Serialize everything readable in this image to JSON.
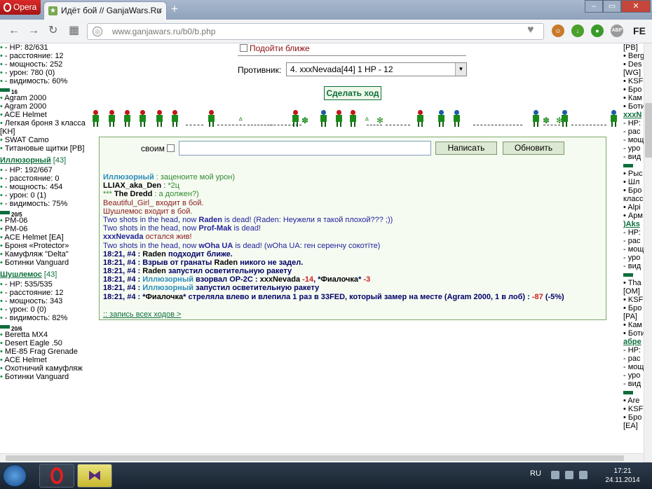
{
  "browser": {
    "menu_label": "Opera",
    "tab_title": "Идёт бой // GanjaWars.Ru",
    "tab_close": "×",
    "new_tab": "+",
    "window_min": "–",
    "window_max": "▭",
    "window_close": "✕",
    "url": "www.ganjawars.ru/b0/b.php",
    "nav_back": "←",
    "nav_forward": "→",
    "nav_reload": "↻",
    "nav_speeddial": "▦",
    "heart": "♥",
    "ext_abp": "ABP",
    "ext_fe": "FE"
  },
  "left_panel": {
    "top_lines": [
      {
        "dot": true,
        "text": "- HP: 82/631"
      },
      {
        "dot": true,
        "text": "- расстояние: 12"
      },
      {
        "dot": true,
        "text": "- мощность: 252"
      },
      {
        "dot": true,
        "text": "- урон: 780 (0)"
      },
      {
        "dot": true,
        "text": "- видимость: 60%"
      }
    ],
    "top_gun": "16",
    "top_items": [
      "Agram 2000",
      "Agram 2000",
      "ACE Helmet",
      "Легкая броня 3 класса [KH]",
      "SWAT Camo",
      "Титановые щитки [PB]"
    ],
    "players": [
      {
        "name": "Иллюзорный",
        "level": "[43]",
        "stats": [
          "- HP: 192/667",
          "- расстояние: 0",
          "- мощность: 454",
          "- урон: 0 (1)",
          "- видимость: 75%"
        ],
        "gun": "20/5",
        "items": [
          "PM-06",
          "PM-06",
          "ACE Helmet [EA]",
          "Броня «Protector»",
          "Камуфляж \"Delta\"",
          "Ботинки Vanguard"
        ]
      },
      {
        "name": "Шушлемос",
        "level": "[43]",
        "stats": [
          "- HP: 535/535",
          "- расстояние: 12",
          "- мощность: 343",
          "- урон: 0 (0)",
          "- видимость: 82%"
        ],
        "gun": "20/6",
        "items": [
          "Beretta MX4",
          "Desert Eagle .50",
          "ME-85 Frag Grenade",
          "ACE Helmet",
          "Охотничий камуфляж",
          "Ботинки Vanguard"
        ]
      }
    ]
  },
  "battle": {
    "approach_label": "Подойти ближе",
    "opponent_label": "Противник:",
    "opponent_selected": "4. xxxNevada[44] 1 HP - 12",
    "make_move": "Сделать ход"
  },
  "chat": {
    "own_label": "своим",
    "input_value": "",
    "write_button": "Написать",
    "refresh_button": "Обновить",
    "all_moves_link": ":: запись всех ходов >"
  },
  "log": [
    [
      {
        "t": "Иллюзорный",
        "c": "bcyan"
      },
      {
        "t": " : заценоите мой урон)",
        "c": "c-green"
      }
    ],
    [
      {
        "t": "LLIAX_aka_Den",
        "c": "bold"
      },
      {
        "t": " : ",
        "c": "c-blue"
      },
      {
        "t": "*2ц",
        "c": "c-green"
      }
    ],
    [
      {
        "t": "*** ",
        "c": "c-green"
      },
      {
        "t": "The Dredd",
        "c": "bold"
      },
      {
        "t": " : а должен?)",
        "c": "c-green"
      }
    ],
    [
      {
        "t": "Beautiful_Girl_ входит в бой.",
        "c": "c-dkred"
      }
    ],
    [
      {
        "t": "Шушлемос входит в бой.",
        "c": "c-dkred"
      }
    ],
    [
      {
        "t": "Two shots in the head, now ",
        "c": "c-blue"
      },
      {
        "t": "Raden",
        "c": "bblue"
      },
      {
        "t": " is dead! (Raden: Неужели я такой плохой??? ;))",
        "c": "c-blue"
      }
    ],
    [
      {
        "t": "Two shots in the head, now ",
        "c": "c-blue"
      },
      {
        "t": "Prof-Mak",
        "c": "bblue"
      },
      {
        "t": " is dead!",
        "c": "c-blue"
      }
    ],
    [
      {
        "t": "xxxNevada",
        "c": "bblue"
      },
      {
        "t": " остался жив!",
        "c": "c-dkred"
      }
    ],
    [
      {
        "t": "Two shots in the head, now ",
        "c": "c-blue"
      },
      {
        "t": "wOha UA",
        "c": "bblue"
      },
      {
        "t": " is dead! (wOha UA: ген серенчу сокотїте)",
        "c": "c-blue"
      }
    ],
    [
      {
        "t": "18:21, #4 : ",
        "c": "navy"
      },
      {
        "t": "Raden",
        "c": "bold"
      },
      {
        "t": " подходит ближе.",
        "c": "navy"
      }
    ],
    [
      {
        "t": "18:21, #4 : Взрыв от гранаты ",
        "c": "navy"
      },
      {
        "t": "Raden",
        "c": "bold"
      },
      {
        "t": " никого не задел.",
        "c": "navy"
      }
    ],
    [
      {
        "t": "18:21, #4 : ",
        "c": "navy"
      },
      {
        "t": "Raden",
        "c": "bold"
      },
      {
        "t": " запустил осветительную ракету",
        "c": "navy"
      }
    ],
    [
      {
        "t": "18:21, #4 : ",
        "c": "navy"
      },
      {
        "t": "Иллюзорный",
        "c": "bcyan"
      },
      {
        "t": " взорвал OP-2C : ",
        "c": "navy"
      },
      {
        "t": "xxxNevada",
        "c": "bold"
      },
      {
        "t": " -14",
        "c": "c-red"
      },
      {
        "t": ", *",
        "c": "navy"
      },
      {
        "t": "Фиалочка",
        "c": "bold"
      },
      {
        "t": "* ",
        "c": "navy"
      },
      {
        "t": "-3",
        "c": "c-red"
      }
    ],
    [
      {
        "t": "18:21, #4 : ",
        "c": "navy"
      },
      {
        "t": "Иллюзорный",
        "c": "bcyan"
      },
      {
        "t": " запустил осветительную ракету",
        "c": "navy"
      }
    ],
    [
      {
        "t": "18:21, #4 : *",
        "c": "navy"
      },
      {
        "t": "Фиалочка",
        "c": "bold"
      },
      {
        "t": "* стреляла влево и влепила 1 раз в 33FED, который замер на месте (Agram 2000, 1 в лоб) : ",
        "c": "navy"
      },
      {
        "t": "-87",
        "c": "c-red"
      },
      {
        "t": " (-5%)",
        "c": "navy"
      }
    ]
  ],
  "right_panel": [
    "[PB]",
    "• Berg",
    "• Des",
    "[WG]",
    "• KSF",
    "• Бро",
    "• Кам",
    "• Боти",
    "xxxN",
    "- HP:",
    "- рас",
    "- мощ",
    "- уро",
    "- вид",
    "",
    "• Рыс",
    "• Шл",
    "• Бро",
    "класс",
    "• Alpi",
    "• Арм",
    ")Aks",
    "- HP:",
    "- рас",
    "- мощ",
    "- уро",
    "- вид",
    "",
    "• Tha",
    "[OM]",
    "• KSF",
    "• Бро",
    "[PA]",
    "• Кам",
    "• Боти",
    "абре",
    "- HP:",
    "- рас",
    "- мощ",
    "- уро",
    "- вид",
    "",
    "• Are",
    "• KSF",
    "• Бро",
    "[EA]"
  ],
  "taskbar": {
    "lang": "RU",
    "time": "17:21",
    "date": "24.11.2014"
  },
  "colors": {
    "site_green": "#0d6e3c",
    "chat_blue": "#22229a",
    "damage_red": "#d02020"
  }
}
